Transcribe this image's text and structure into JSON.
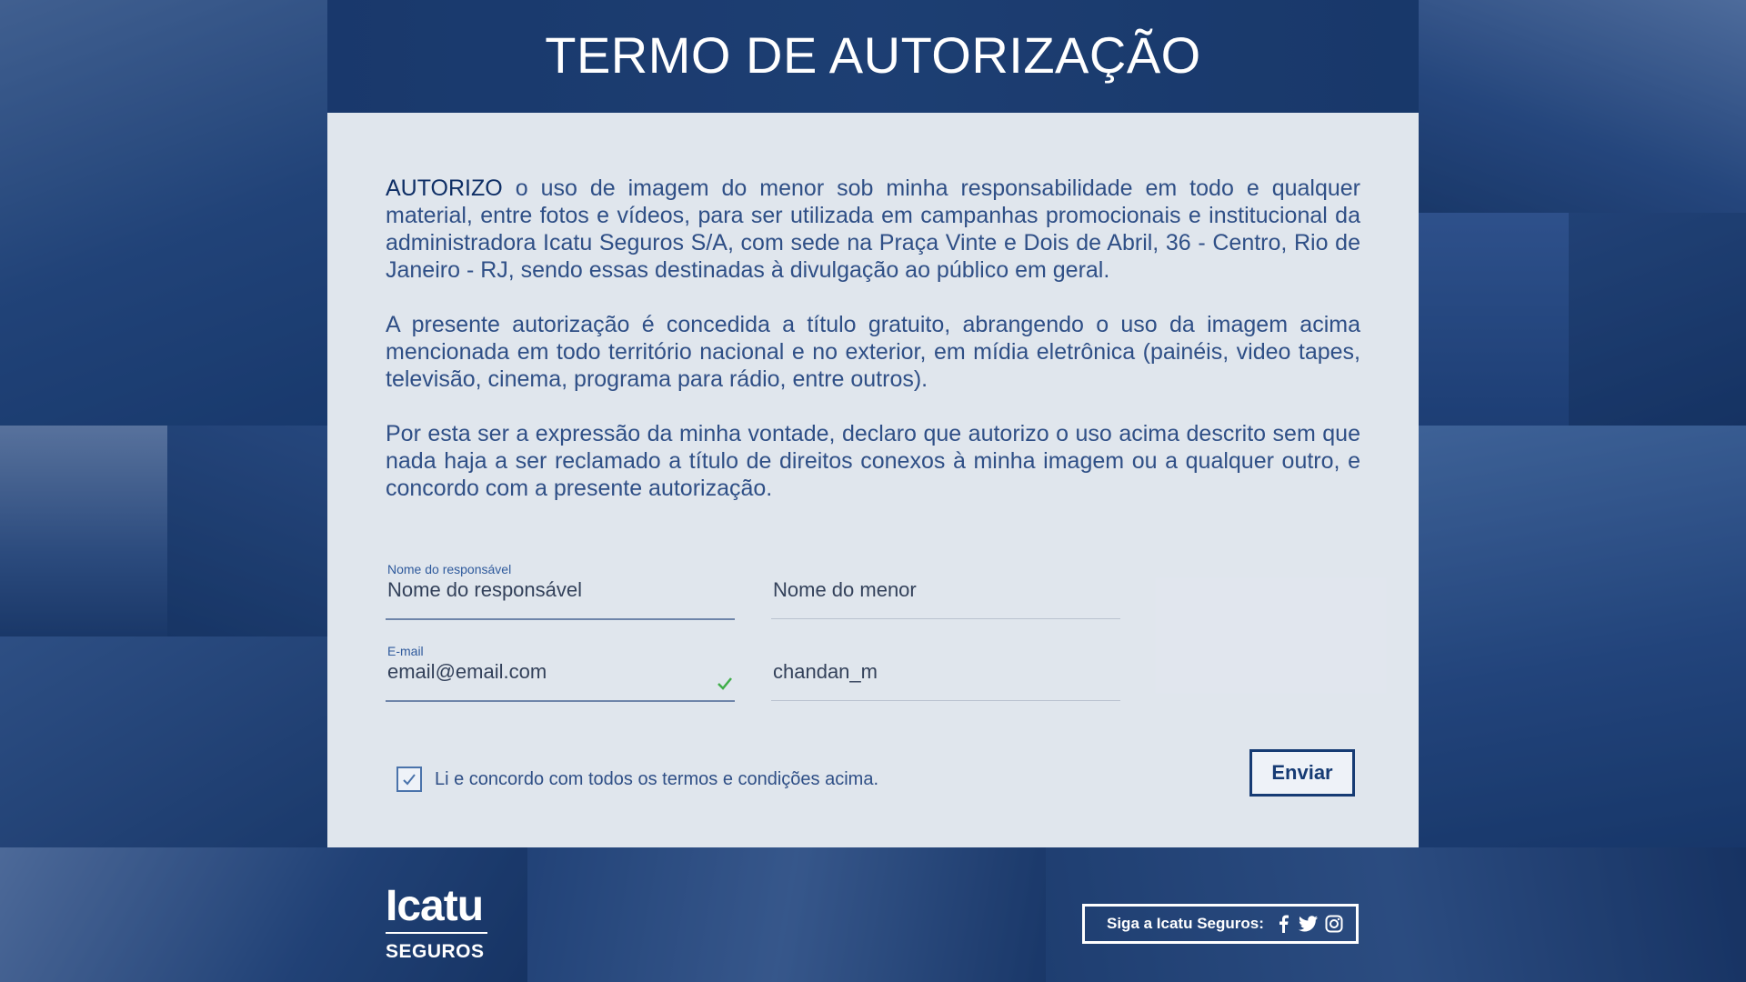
{
  "page": {
    "title": "TERMO DE AUTORIZAÇÃO"
  },
  "terms": {
    "lead_word": "AUTORIZO",
    "paragraph_1_rest": " o uso de imagem do menor sob minha responsabilidade em todo e qualquer material, entre fotos e vídeos, para ser utilizada em campanhas promocionais e institucional da administradora Icatu Seguros S/A, com sede na Praça Vinte e Dois de Abril, 36 - Centro, Rio de Janeiro - RJ, sendo essas destinadas à divulgação ao público em geral.",
    "paragraph_2": "A presente autorização é concedida a título gratuito, abrangendo o uso da imagem acima mencionada em todo território nacional e no exterior, em mídia eletrônica (painéis, video tapes, televisão, cinema, programa para rádio, entre outros).",
    "paragraph_3": "Por esta ser a expressão da minha vontade, declaro que autorizo o uso acima descrito sem que nada haja a ser reclamado a título de direitos conexos à minha imagem ou a qualquer outro, e concordo com a presente autorização."
  },
  "form": {
    "responsible": {
      "label": "Nome do responsável",
      "value": "Nome do responsável"
    },
    "minor": {
      "value": "Nome do menor"
    },
    "email": {
      "label": "E-mail",
      "value": "email@email.com"
    },
    "extra": {
      "value": "chandan_m"
    },
    "agree_label": "Li e concordo com todos os termos e condições acima.",
    "agree_checked": true,
    "submit_label": "Enviar"
  },
  "footer": {
    "logo_word": "Icatu",
    "logo_sub": "SEGUROS",
    "social_label": "Siga a Icatu Seguros:",
    "social_icons": [
      "facebook-icon",
      "twitter-icon",
      "instagram-icon"
    ]
  },
  "colors": {
    "brand_dark": "#163b74",
    "text_blue": "#2f4f86",
    "valid_green": "#3fae49"
  }
}
